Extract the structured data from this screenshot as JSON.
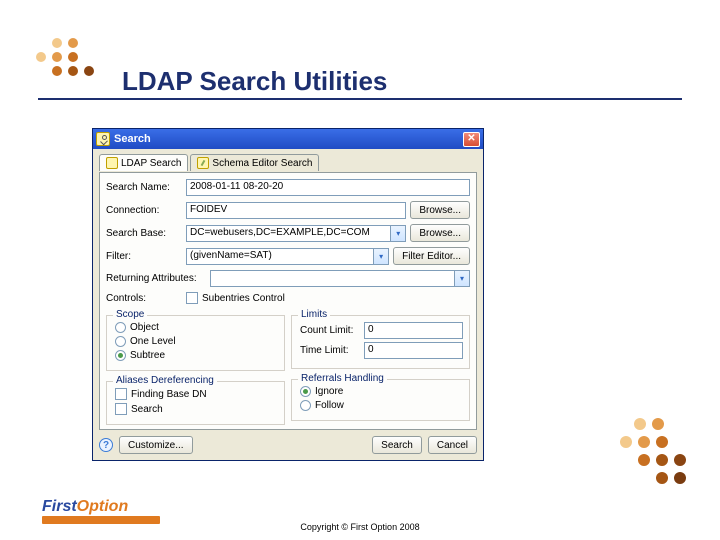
{
  "slide": {
    "title": "LDAP Search Utilities",
    "copyright": "Copyright © First Option 2008",
    "logo_first": "First",
    "logo_option": "Option"
  },
  "window": {
    "title": "Search",
    "close_glyph": "✕",
    "tabs": {
      "ldap": "LDAP Search",
      "schema": "Schema Editor Search"
    },
    "fields": {
      "search_name_label": "Search Name:",
      "search_name_value": "2008-01-11 08-20-20",
      "connection_label": "Connection:",
      "connection_value": "FOIDEV",
      "search_base_label": "Search Base:",
      "search_base_value": "DC=webusers,DC=EXAMPLE,DC=COM",
      "filter_label": "Filter:",
      "filter_value": "(givenName=SAT)",
      "returning_attrs_label": "Returning Attributes:",
      "returning_attrs_value": "",
      "controls_label": "Controls:",
      "controls_check_label": "Subentries Control"
    },
    "buttons": {
      "browse": "Browse...",
      "filter_editor": "Filter Editor...",
      "customize": "Customize...",
      "search": "Search",
      "cancel": "Cancel",
      "dropdown_glyph": "▾",
      "help_glyph": "?"
    },
    "groups": {
      "scope": {
        "label": "Scope",
        "object": "Object",
        "one_level": "One Level",
        "subtree": "Subtree"
      },
      "limits": {
        "label": "Limits",
        "count_label": "Count Limit:",
        "count_value": "0",
        "time_label": "Time Limit:",
        "time_value": "0"
      },
      "aliases": {
        "label": "Aliases Dereferencing",
        "finding": "Finding Base DN",
        "search": "Search"
      },
      "referrals": {
        "label": "Referrals Handling",
        "ignore": "Ignore",
        "follow": "Follow"
      }
    }
  }
}
